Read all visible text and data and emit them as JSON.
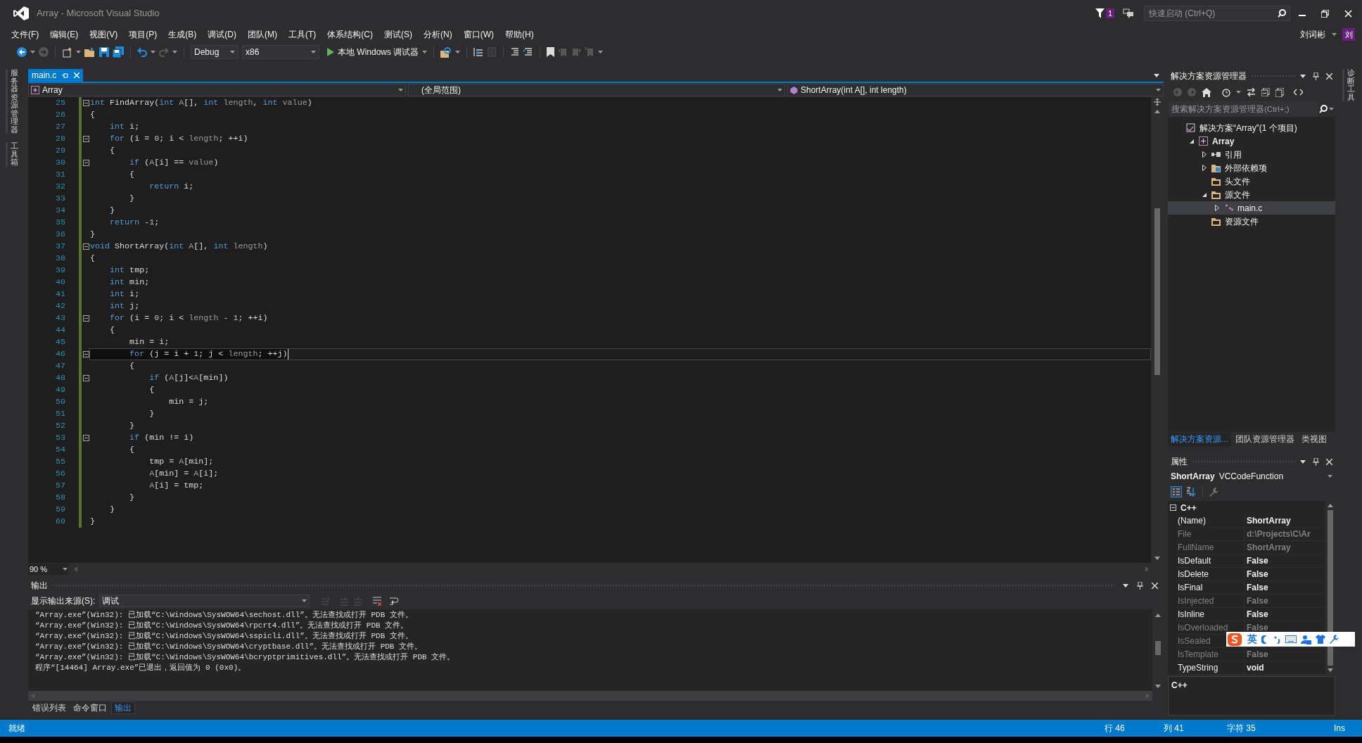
{
  "window": {
    "title": "Array - Microsoft Visual Studio",
    "notification_count": "1",
    "quick_launch": {
      "placeholder": "快速启动 (Ctrl+Q)"
    },
    "user": {
      "name": "刘词彬",
      "avatar": "刘"
    }
  },
  "menu": [
    "文件(F)",
    "编辑(E)",
    "视图(V)",
    "项目(P)",
    "生成(B)",
    "调试(D)",
    "团队(M)",
    "工具(T)",
    "体系结构(C)",
    "测试(S)",
    "分析(N)",
    "窗口(W)",
    "帮助(H)"
  ],
  "toolbar": {
    "configuration": "Debug",
    "platform": "x86",
    "debugger": "本地 Windows 调试器"
  },
  "left_tool_tabs": [
    "服务器资源管理器",
    "工具箱"
  ],
  "right_tool_tabs": [
    "诊断工具"
  ],
  "editor": {
    "tabs": [
      {
        "label": "main.c",
        "selected": true
      }
    ],
    "nav": {
      "project": "Array",
      "scope": "(全局范围)",
      "member": "ShortArray(int A[], int length)"
    },
    "zoom": "90 %",
    "lines": [
      {
        "number": "25",
        "fold": true,
        "current": false,
        "tokens": [
          {
            "kind": "keyword",
            "text": "int"
          },
          {
            "kind": "plain",
            "text": " FindArray("
          },
          {
            "kind": "keyword",
            "text": "int"
          },
          {
            "kind": "param",
            "text": " A"
          },
          {
            "kind": "plain",
            "text": "[], "
          },
          {
            "kind": "keyword",
            "text": "int"
          },
          {
            "kind": "param",
            "text": " length"
          },
          {
            "kind": "plain",
            "text": ", "
          },
          {
            "kind": "keyword",
            "text": "int"
          },
          {
            "kind": "param",
            "text": " value"
          },
          {
            "kind": "plain",
            "text": ")"
          }
        ]
      },
      {
        "number": "26",
        "fold": false,
        "current": false,
        "tokens": [
          {
            "kind": "plain",
            "text": "{"
          }
        ]
      },
      {
        "number": "27",
        "fold": false,
        "current": false,
        "tokens": [
          {
            "kind": "keyword",
            "text": "    int"
          },
          {
            "kind": "plain",
            "text": " i;"
          }
        ]
      },
      {
        "number": "28",
        "fold": true,
        "current": false,
        "tokens": [
          {
            "kind": "keyword",
            "text": "    for"
          },
          {
            "kind": "plain",
            "text": " (i = "
          },
          {
            "kind": "number",
            "text": "0"
          },
          {
            "kind": "plain",
            "text": "; i < "
          },
          {
            "kind": "param",
            "text": "length"
          },
          {
            "kind": "plain",
            "text": "; ++i)"
          }
        ]
      },
      {
        "number": "29",
        "fold": false,
        "current": false,
        "tokens": [
          {
            "kind": "plain",
            "text": "    {"
          }
        ]
      },
      {
        "number": "30",
        "fold": true,
        "current": false,
        "tokens": [
          {
            "kind": "keyword",
            "text": "        if"
          },
          {
            "kind": "plain",
            "text": " ("
          },
          {
            "kind": "param",
            "text": "A"
          },
          {
            "kind": "plain",
            "text": "[i] == "
          },
          {
            "kind": "param",
            "text": "value"
          },
          {
            "kind": "plain",
            "text": ")"
          }
        ]
      },
      {
        "number": "31",
        "fold": false,
        "current": false,
        "tokens": [
          {
            "kind": "plain",
            "text": "        {"
          }
        ]
      },
      {
        "number": "32",
        "fold": false,
        "current": false,
        "tokens": [
          {
            "kind": "keyword",
            "text": "            return"
          },
          {
            "kind": "plain",
            "text": " i;"
          }
        ]
      },
      {
        "number": "33",
        "fold": false,
        "current": false,
        "tokens": [
          {
            "kind": "plain",
            "text": "        }"
          }
        ]
      },
      {
        "number": "34",
        "fold": false,
        "current": false,
        "tokens": [
          {
            "kind": "plain",
            "text": "    }"
          }
        ]
      },
      {
        "number": "35",
        "fold": false,
        "current": false,
        "tokens": [
          {
            "kind": "keyword",
            "text": "    return"
          },
          {
            "kind": "plain",
            "text": " -"
          },
          {
            "kind": "number",
            "text": "1"
          },
          {
            "kind": "plain",
            "text": ";"
          }
        ]
      },
      {
        "number": "36",
        "fold": false,
        "current": false,
        "tokens": [
          {
            "kind": "plain",
            "text": "}"
          }
        ]
      },
      {
        "number": "37",
        "fold": true,
        "current": false,
        "tokens": [
          {
            "kind": "keyword",
            "text": "void"
          },
          {
            "kind": "plain",
            "text": " ShortArray("
          },
          {
            "kind": "keyword",
            "text": "int"
          },
          {
            "kind": "param",
            "text": " A"
          },
          {
            "kind": "plain",
            "text": "[], "
          },
          {
            "kind": "keyword",
            "text": "int"
          },
          {
            "kind": "param",
            "text": " length"
          },
          {
            "kind": "plain",
            "text": ")"
          }
        ]
      },
      {
        "number": "38",
        "fold": false,
        "current": false,
        "tokens": [
          {
            "kind": "plain",
            "text": "{"
          }
        ]
      },
      {
        "number": "39",
        "fold": false,
        "current": false,
        "tokens": [
          {
            "kind": "keyword",
            "text": "    int"
          },
          {
            "kind": "plain",
            "text": " tmp;"
          }
        ]
      },
      {
        "number": "40",
        "fold": false,
        "current": false,
        "tokens": [
          {
            "kind": "keyword",
            "text": "    int"
          },
          {
            "kind": "plain",
            "text": " min;"
          }
        ]
      },
      {
        "number": "41",
        "fold": false,
        "current": false,
        "tokens": [
          {
            "kind": "keyword",
            "text": "    int"
          },
          {
            "kind": "plain",
            "text": " i;"
          }
        ]
      },
      {
        "number": "42",
        "fold": false,
        "current": false,
        "tokens": [
          {
            "kind": "keyword",
            "text": "    int"
          },
          {
            "kind": "plain",
            "text": " j;"
          }
        ]
      },
      {
        "number": "43",
        "fold": true,
        "current": false,
        "tokens": [
          {
            "kind": "keyword",
            "text": "    for"
          },
          {
            "kind": "plain",
            "text": " (i = "
          },
          {
            "kind": "number",
            "text": "0"
          },
          {
            "kind": "plain",
            "text": "; i < "
          },
          {
            "kind": "param",
            "text": "length"
          },
          {
            "kind": "plain",
            "text": " - "
          },
          {
            "kind": "number",
            "text": "1"
          },
          {
            "kind": "plain",
            "text": "; ++i)"
          }
        ]
      },
      {
        "number": "44",
        "fold": false,
        "current": false,
        "tokens": [
          {
            "kind": "plain",
            "text": "    {"
          }
        ]
      },
      {
        "number": "45",
        "fold": false,
        "current": false,
        "tokens": [
          {
            "kind": "plain",
            "text": "        min = i;"
          }
        ]
      },
      {
        "number": "46",
        "fold": true,
        "current": true,
        "tokens": [
          {
            "kind": "keyword",
            "text": "        for"
          },
          {
            "kind": "plain",
            "text": " (j = i + "
          },
          {
            "kind": "number",
            "text": "1"
          },
          {
            "kind": "plain",
            "text": "; j < "
          },
          {
            "kind": "param",
            "text": "length"
          },
          {
            "kind": "plain",
            "text": "; ++j)"
          }
        ]
      },
      {
        "number": "47",
        "fold": false,
        "current": false,
        "tokens": [
          {
            "kind": "plain",
            "text": "        {"
          }
        ]
      },
      {
        "number": "48",
        "fold": true,
        "current": false,
        "tokens": [
          {
            "kind": "keyword",
            "text": "            if"
          },
          {
            "kind": "plain",
            "text": " ("
          },
          {
            "kind": "param",
            "text": "A"
          },
          {
            "kind": "plain",
            "text": "[j]<"
          },
          {
            "kind": "param",
            "text": "A"
          },
          {
            "kind": "plain",
            "text": "[min])"
          }
        ]
      },
      {
        "number": "49",
        "fold": false,
        "current": false,
        "tokens": [
          {
            "kind": "plain",
            "text": "            {"
          }
        ]
      },
      {
        "number": "50",
        "fold": false,
        "current": false,
        "tokens": [
          {
            "kind": "plain",
            "text": "                min = j;"
          }
        ]
      },
      {
        "number": "51",
        "fold": false,
        "current": false,
        "tokens": [
          {
            "kind": "plain",
            "text": "            }"
          }
        ]
      },
      {
        "number": "52",
        "fold": false,
        "current": false,
        "tokens": [
          {
            "kind": "plain",
            "text": "        }"
          }
        ]
      },
      {
        "number": "53",
        "fold": true,
        "current": false,
        "tokens": [
          {
            "kind": "keyword",
            "text": "        if"
          },
          {
            "kind": "plain",
            "text": " (min != i)"
          }
        ]
      },
      {
        "number": "54",
        "fold": false,
        "current": false,
        "tokens": [
          {
            "kind": "plain",
            "text": "        {"
          }
        ]
      },
      {
        "number": "55",
        "fold": false,
        "current": false,
        "tokens": [
          {
            "kind": "plain",
            "text": "            tmp = "
          },
          {
            "kind": "param",
            "text": "A"
          },
          {
            "kind": "plain",
            "text": "[min];"
          }
        ]
      },
      {
        "number": "56",
        "fold": false,
        "current": false,
        "tokens": [
          {
            "kind": "param",
            "text": "            A"
          },
          {
            "kind": "plain",
            "text": "[min] = "
          },
          {
            "kind": "param",
            "text": "A"
          },
          {
            "kind": "plain",
            "text": "[i];"
          }
        ]
      },
      {
        "number": "57",
        "fold": false,
        "current": false,
        "tokens": [
          {
            "kind": "param",
            "text": "            A"
          },
          {
            "kind": "plain",
            "text": "[i] = tmp;"
          }
        ]
      },
      {
        "number": "58",
        "fold": false,
        "current": false,
        "tokens": [
          {
            "kind": "plain",
            "text": "        }"
          }
        ]
      },
      {
        "number": "59",
        "fold": false,
        "current": false,
        "tokens": [
          {
            "kind": "plain",
            "text": "    }"
          }
        ]
      },
      {
        "number": "60",
        "fold": false,
        "current": false,
        "tokens": [
          {
            "kind": "plain",
            "text": "}"
          }
        ]
      }
    ]
  },
  "output": {
    "title": "输出",
    "source_label": "显示输出来源(S):",
    "source": "调试",
    "lines": [
      "“Array.exe”(Win32): 已加载“C:\\Windows\\SysWOW64\\sechost.dll”。无法查找或打开 PDB 文件。",
      "“Array.exe”(Win32): 已加载“C:\\Windows\\SysWOW64\\rpcrt4.dll”。无法查找或打开 PDB 文件。",
      "“Array.exe”(Win32): 已加载“C:\\Windows\\SysWOW64\\sspicli.dll”。无法查找或打开 PDB 文件。",
      "“Array.exe”(Win32): 已加载“C:\\Windows\\SysWOW64\\cryptbase.dll”。无法查找或打开 PDB 文件。",
      "“Array.exe”(Win32): 已加载“C:\\Windows\\SysWOW64\\bcryptprimitives.dll”。无法查找或打开 PDB 文件。",
      "程序“[14464] Array.exe”已退出，返回值为 0 (0x0)。"
    ]
  },
  "bottom_tabs": [
    {
      "label": "错误列表",
      "selected": false
    },
    {
      "label": "命令窗口",
      "selected": false
    },
    {
      "label": "输出",
      "selected": true
    }
  ],
  "solution_explorer": {
    "title": "解决方案资源管理器",
    "search": {
      "placeholder": "搜索解决方案资源管理器(Ctrl+;)"
    },
    "tree": [
      {
        "label": "解决方案“Array”(1 个项目)",
        "kind": "solution",
        "expandable": false,
        "selected": false,
        "children": [
          {
            "label": "Array",
            "kind": "project",
            "expandable": true,
            "expanded": true,
            "selected": false,
            "children": [
              {
                "label": "引用",
                "kind": "references",
                "expandable": true,
                "expanded": false,
                "selected": false
              },
              {
                "label": "外部依赖项",
                "kind": "dependencies",
                "expandable": true,
                "expanded": false,
                "selected": false
              },
              {
                "label": "头文件",
                "kind": "folder",
                "expandable": false,
                "selected": false
              },
              {
                "label": "源文件",
                "kind": "folder",
                "expandable": true,
                "expanded": true,
                "selected": false,
                "children": [
                  {
                    "label": "main.c",
                    "kind": "source",
                    "expandable": true,
                    "expanded": false,
                    "selected": true
                  }
                ]
              },
              {
                "label": "资源文件",
                "kind": "folder",
                "expandable": false,
                "selected": false
              }
            ]
          }
        ]
      }
    ]
  },
  "panel_tabs": [
    {
      "label": "解决方案资源...",
      "selected": true
    },
    {
      "label": "团队资源管理器",
      "selected": false
    },
    {
      "label": "类视图",
      "selected": false
    }
  ],
  "properties": {
    "title": "属性",
    "object": "ShortArray",
    "type": "VCCodeFunction",
    "category": "C++",
    "expanded": true,
    "rows": [
      {
        "name": "(Name)",
        "value": "ShortArray",
        "readonly": false
      },
      {
        "name": "File",
        "value": "d:\\Projects\\C\\Ar",
        "readonly": true
      },
      {
        "name": "FullName",
        "value": "ShortArray",
        "readonly": true
      },
      {
        "name": "IsDefault",
        "value": "False",
        "readonly": false
      },
      {
        "name": "IsDelete",
        "value": "False",
        "readonly": false
      },
      {
        "name": "IsFinal",
        "value": "False",
        "readonly": false
      },
      {
        "name": "IsInjected",
        "value": "False",
        "readonly": true
      },
      {
        "name": "IsInline",
        "value": "False",
        "readonly": false
      },
      {
        "name": "IsOverloaded",
        "value": "False",
        "readonly": true
      },
      {
        "name": "IsSealed",
        "readonly": true
      },
      {
        "name": "IsTemplate",
        "value": "False",
        "readonly": true
      },
      {
        "name": "TypeString",
        "value": "void",
        "readonly": false
      }
    ],
    "description": "C++"
  },
  "ime_bar": {
    "mode": "英"
  },
  "status_bar": {
    "message": "就绪",
    "line": "行 46",
    "column": "列 41",
    "char": "字符 35",
    "mode": "Ins"
  }
}
